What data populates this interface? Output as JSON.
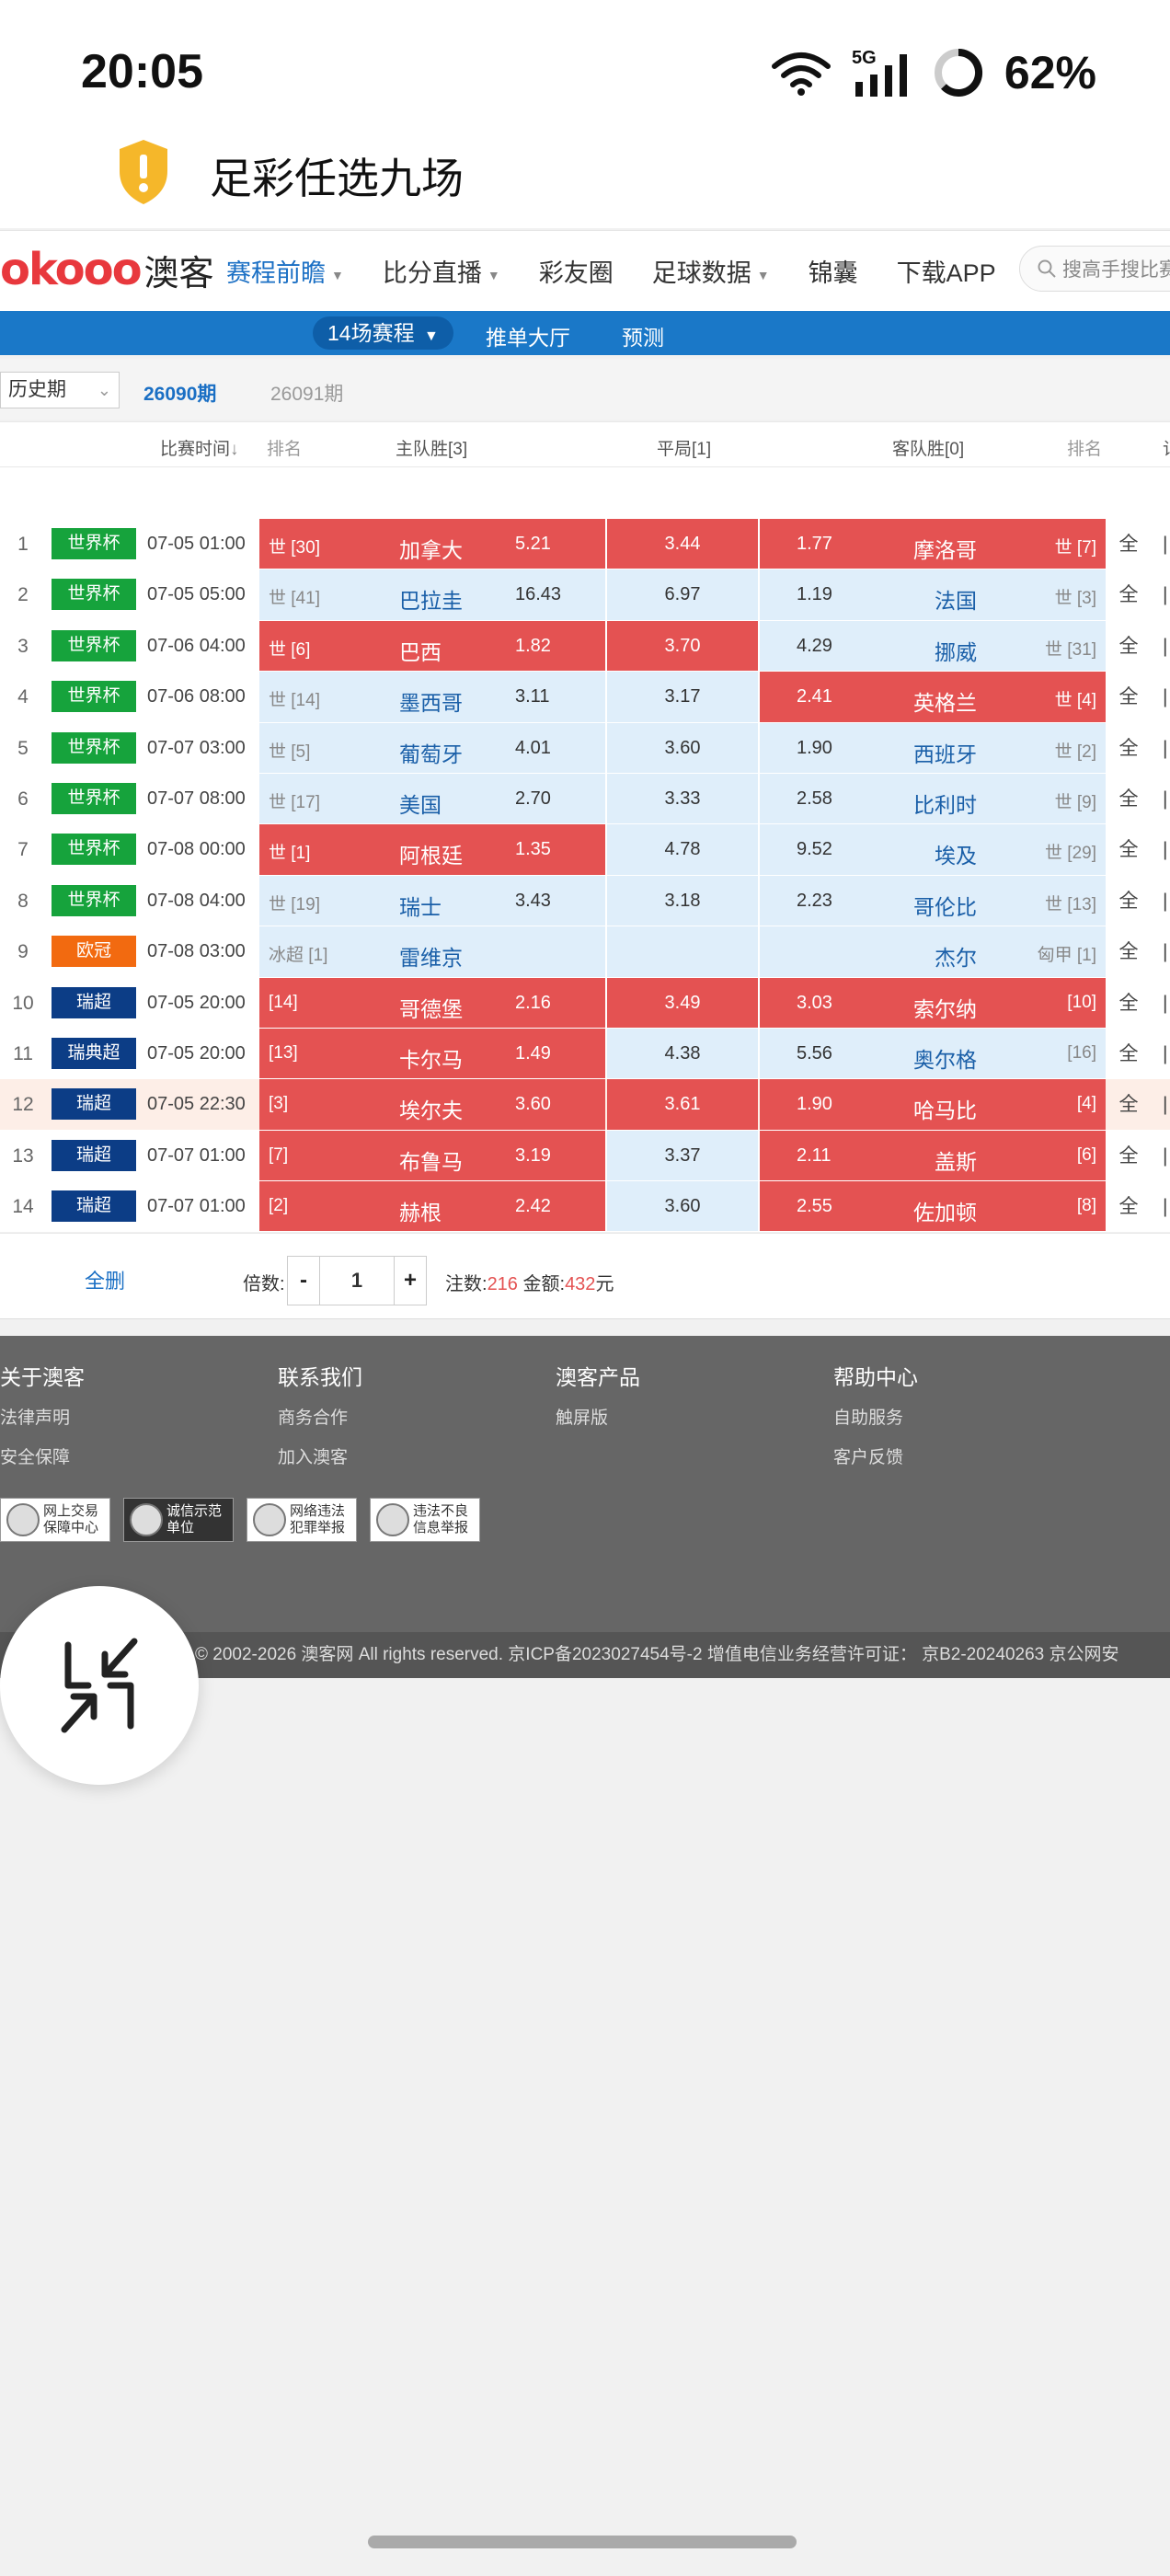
{
  "status_bar": {
    "time": "20:05",
    "network": "5G",
    "battery": "62%"
  },
  "app_title": "足彩任选九场",
  "brand": {
    "logo_text": "okooo",
    "logo_cn": "澳客"
  },
  "nav": {
    "items": [
      {
        "label": "赛程前瞻",
        "caret": true,
        "active": true
      },
      {
        "label": "比分直播",
        "caret": true
      },
      {
        "label": "彩友圈",
        "caret": false
      },
      {
        "label": "足球数据",
        "caret": true
      },
      {
        "label": "锦囊",
        "caret": false
      },
      {
        "label": "下载APP",
        "caret": false
      }
    ],
    "search_placeholder": "搜高手搜比赛"
  },
  "subnav": {
    "selected": "14场赛程",
    "links": [
      "推单大厅",
      "预测"
    ]
  },
  "periods": {
    "history_select": "历史期",
    "current": "26090期",
    "next": "26091期"
  },
  "table_header": {
    "time": "比赛时间",
    "rank": "排名",
    "home": "主队胜[3]",
    "draw": "平局[1]",
    "away": "客队胜[0]",
    "rank2": "排名",
    "cut": "记"
  },
  "league_colors": {
    "世界杯": "#16a33c",
    "欧冠": "#f26a10",
    "瑞超": "#0c3d86",
    "瑞典超": "#0c3d86"
  },
  "matches": [
    {
      "no": "1",
      "league": "世界杯",
      "time": "07-05 01:00",
      "home_rank": "世 [30]",
      "home": "加拿大",
      "home_odds": "5.21",
      "draw_odds": "3.44",
      "away_odds": "1.77",
      "away": "摩洛哥",
      "away_rank": "世 [7]",
      "sel_home": true,
      "sel_draw": true,
      "sel_away": true,
      "all": "全"
    },
    {
      "no": "2",
      "league": "世界杯",
      "time": "07-05 05:00",
      "home_rank": "世 [41]",
      "home": "巴拉圭",
      "home_odds": "16.43",
      "draw_odds": "6.97",
      "away_odds": "1.19",
      "away": "法国",
      "away_rank": "世 [3]",
      "sel_home": false,
      "sel_draw": false,
      "sel_away": false,
      "all": "全"
    },
    {
      "no": "3",
      "league": "世界杯",
      "time": "07-06 04:00",
      "home_rank": "世 [6]",
      "home": "巴西",
      "home_odds": "1.82",
      "draw_odds": "3.70",
      "away_odds": "4.29",
      "away": "挪威",
      "away_rank": "世 [31]",
      "sel_home": true,
      "sel_draw": true,
      "sel_away": false,
      "all": "全"
    },
    {
      "no": "4",
      "league": "世界杯",
      "time": "07-06 08:00",
      "home_rank": "世 [14]",
      "home": "墨西哥",
      "home_odds": "3.11",
      "draw_odds": "3.17",
      "away_odds": "2.41",
      "away": "英格兰",
      "away_rank": "世 [4]",
      "sel_home": false,
      "sel_draw": false,
      "sel_away": true,
      "all": "全"
    },
    {
      "no": "5",
      "league": "世界杯",
      "time": "07-07 03:00",
      "home_rank": "世 [5]",
      "home": "葡萄牙",
      "home_odds": "4.01",
      "draw_odds": "3.60",
      "away_odds": "1.90",
      "away": "西班牙",
      "away_rank": "世 [2]",
      "sel_home": false,
      "sel_draw": false,
      "sel_away": false,
      "all": "全"
    },
    {
      "no": "6",
      "league": "世界杯",
      "time": "07-07 08:00",
      "home_rank": "世 [17]",
      "home": "美国",
      "home_odds": "2.70",
      "draw_odds": "3.33",
      "away_odds": "2.58",
      "away": "比利时",
      "away_rank": "世 [9]",
      "sel_home": false,
      "sel_draw": false,
      "sel_away": false,
      "all": "全"
    },
    {
      "no": "7",
      "league": "世界杯",
      "time": "07-08 00:00",
      "home_rank": "世 [1]",
      "home": "阿根廷",
      "home_odds": "1.35",
      "draw_odds": "4.78",
      "away_odds": "9.52",
      "away": "埃及",
      "away_rank": "世 [29]",
      "sel_home": true,
      "sel_draw": false,
      "sel_away": false,
      "all": "全"
    },
    {
      "no": "8",
      "league": "世界杯",
      "time": "07-08 04:00",
      "home_rank": "世 [19]",
      "home": "瑞士",
      "home_odds": "3.43",
      "draw_odds": "3.18",
      "away_odds": "2.23",
      "away": "哥伦比",
      "away_rank": "世 [13]",
      "sel_home": false,
      "sel_draw": false,
      "sel_away": false,
      "all": "全"
    },
    {
      "no": "9",
      "league": "欧冠",
      "time": "07-08 03:00",
      "home_rank": "冰超 [1]",
      "home": "雷维京",
      "home_odds": "",
      "draw_odds": "",
      "away_odds": "",
      "away": "杰尔",
      "away_rank": "匈甲 [1]",
      "sel_home": false,
      "sel_draw": false,
      "sel_away": false,
      "all": "全"
    },
    {
      "no": "10",
      "league": "瑞超",
      "time": "07-05 20:00",
      "home_rank": "[14]",
      "home": "哥德堡",
      "home_odds": "2.16",
      "draw_odds": "3.49",
      "away_odds": "3.03",
      "away": "索尔纳",
      "away_rank": "[10]",
      "sel_home": true,
      "sel_draw": true,
      "sel_away": true,
      "all": "全"
    },
    {
      "no": "11",
      "league": "瑞典超",
      "time": "07-05 20:00",
      "home_rank": "[13]",
      "home": "卡尔马",
      "home_odds": "1.49",
      "draw_odds": "4.38",
      "away_odds": "5.56",
      "away": "奥尔格",
      "away_rank": "[16]",
      "sel_home": true,
      "sel_draw": false,
      "sel_away": false,
      "all": "全"
    },
    {
      "no": "12",
      "league": "瑞超",
      "time": "07-05 22:30",
      "home_rank": "[3]",
      "home": "埃尔夫",
      "home_odds": "3.60",
      "draw_odds": "3.61",
      "away_odds": "1.90",
      "away": "哈马比",
      "away_rank": "[4]",
      "sel_home": true,
      "sel_draw": true,
      "sel_away": true,
      "all": "全",
      "highlight": true
    },
    {
      "no": "13",
      "league": "瑞超",
      "time": "07-07 01:00",
      "home_rank": "[7]",
      "home": "布鲁马",
      "home_odds": "3.19",
      "draw_odds": "3.37",
      "away_odds": "2.11",
      "away": "盖斯",
      "away_rank": "[6]",
      "sel_home": true,
      "sel_draw": false,
      "sel_away": true,
      "all": "全"
    },
    {
      "no": "14",
      "league": "瑞超",
      "time": "07-07 01:00",
      "home_rank": "[2]",
      "home": "赫根",
      "home_odds": "2.42",
      "draw_odds": "3.60",
      "away_odds": "2.55",
      "away": "佐加顿",
      "away_rank": "[8]",
      "sel_home": true,
      "sel_draw": false,
      "sel_away": true,
      "all": "全"
    }
  ],
  "controls": {
    "clear_all": "全删",
    "multiplier_label": "倍数:",
    "minus": "-",
    "multiplier": "1",
    "plus": "+",
    "bets_label": "注数:",
    "bets": "216",
    "amount_label": "金额:",
    "amount": "432",
    "currency": "元"
  },
  "footer": {
    "columns": [
      {
        "title": "关于澳客",
        "items": [
          "法律声明",
          "安全保障"
        ]
      },
      {
        "title": "联系我们",
        "items": [
          "商务合作",
          "加入澳客"
        ]
      },
      {
        "title": "澳客产品",
        "items": [
          "触屏版"
        ]
      },
      {
        "title": "帮助中心",
        "items": [
          "自助服务",
          "客户反馈"
        ]
      }
    ],
    "badges": [
      "网上交易保障中心",
      "诚信示范单位",
      "网络违法犯罪举报",
      "违法不良信息举报"
    ],
    "copyright": "© 2002-2026 澳客网  All rights reserved.   京ICP备2023027454号-2  增值电信业务经营许可证： 京B2-20240263  京公网安"
  }
}
